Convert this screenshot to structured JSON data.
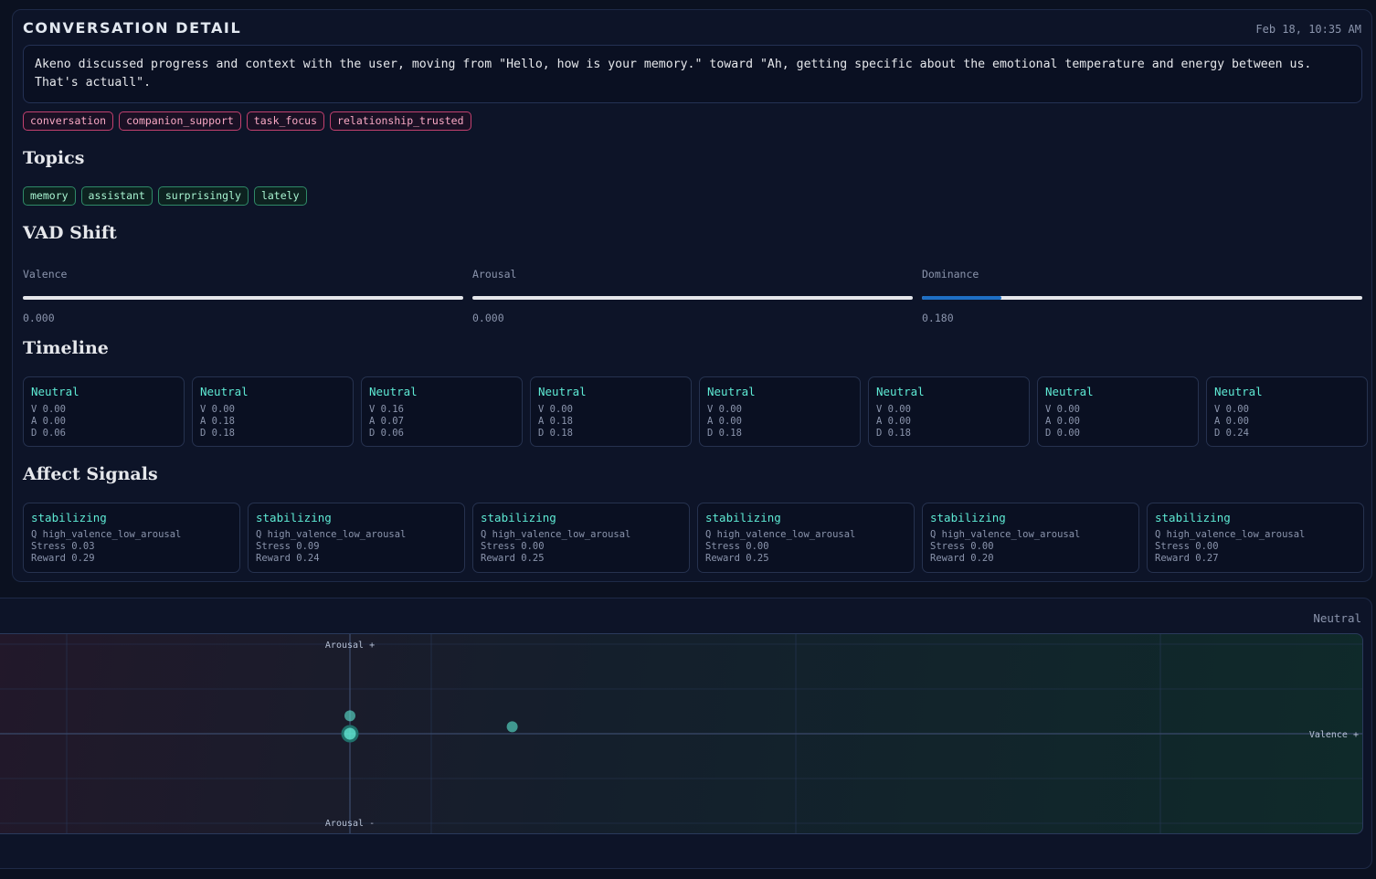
{
  "detail": {
    "title": "CONVERSATION DETAIL",
    "timestamp": "Feb 18, 10:35 AM",
    "summary": "Akeno discussed progress and context with the user, moving from \"Hello, how is your memory.\" toward \"Ah, getting specific about the emotional temperature and energy between us. That's actuall\".",
    "tags": [
      "conversation",
      "companion_support",
      "task_focus",
      "relationship_trusted"
    ],
    "topics_heading": "Topics",
    "topics": [
      "memory",
      "assistant",
      "surprisingly",
      "lately"
    ],
    "vad_heading": "VAD Shift",
    "vad": [
      {
        "label": "Valence",
        "value": "0.000",
        "fill": 0.0
      },
      {
        "label": "Arousal",
        "value": "0.000",
        "fill": 0.0
      },
      {
        "label": "Dominance",
        "value": "0.180",
        "fill": 0.18
      }
    ],
    "timeline_heading": "Timeline",
    "timeline": [
      {
        "label": "Neutral",
        "v": "V 0.00",
        "a": "A 0.00",
        "d": "D 0.06"
      },
      {
        "label": "Neutral",
        "v": "V 0.00",
        "a": "A 0.18",
        "d": "D 0.18"
      },
      {
        "label": "Neutral",
        "v": "V 0.16",
        "a": "A 0.07",
        "d": "D 0.06"
      },
      {
        "label": "Neutral",
        "v": "V 0.00",
        "a": "A 0.18",
        "d": "D 0.18"
      },
      {
        "label": "Neutral",
        "v": "V 0.00",
        "a": "A 0.00",
        "d": "D 0.18"
      },
      {
        "label": "Neutral",
        "v": "V 0.00",
        "a": "A 0.00",
        "d": "D 0.18"
      },
      {
        "label": "Neutral",
        "v": "V 0.00",
        "a": "A 0.00",
        "d": "D 0.00"
      },
      {
        "label": "Neutral",
        "v": "V 0.00",
        "a": "A 0.00",
        "d": "D 0.24"
      }
    ],
    "affect_heading": "Affect Signals",
    "affect": [
      {
        "label": "stabilizing",
        "q": "Q high_valence_low_arousal",
        "stress": "Stress 0.03",
        "reward": "Reward 0.29"
      },
      {
        "label": "stabilizing",
        "q": "Q high_valence_low_arousal",
        "stress": "Stress 0.09",
        "reward": "Reward 0.24"
      },
      {
        "label": "stabilizing",
        "q": "Q high_valence_low_arousal",
        "stress": "Stress 0.00",
        "reward": "Reward 0.25"
      },
      {
        "label": "stabilizing",
        "q": "Q high_valence_low_arousal",
        "stress": "Stress 0.00",
        "reward": "Reward 0.25"
      },
      {
        "label": "stabilizing",
        "q": "Q high_valence_low_arousal",
        "stress": "Stress 0.00",
        "reward": "Reward 0.20"
      },
      {
        "label": "stabilizing",
        "q": "Q high_valence_low_arousal",
        "stress": "Stress 0.00",
        "reward": "Reward 0.27"
      }
    ]
  },
  "map": {
    "status": "Neutral",
    "axis_top": "Arousal +",
    "axis_bottom": "Arousal -",
    "axis_right": "Valence +",
    "colors": {
      "point": "#5eead4",
      "grid": "#2a3a5c",
      "axis": "#3b4a6b"
    }
  },
  "chart_data": {
    "type": "scatter",
    "xlabel": "Valence +",
    "ylabel": "Arousal +",
    "ylim": [
      -1,
      1
    ],
    "points": [
      {
        "x": 0.0,
        "y": 0.0,
        "emphasized": true
      },
      {
        "x": 0.0,
        "y": 0.18
      },
      {
        "x": 0.16,
        "y": 0.07
      }
    ]
  }
}
